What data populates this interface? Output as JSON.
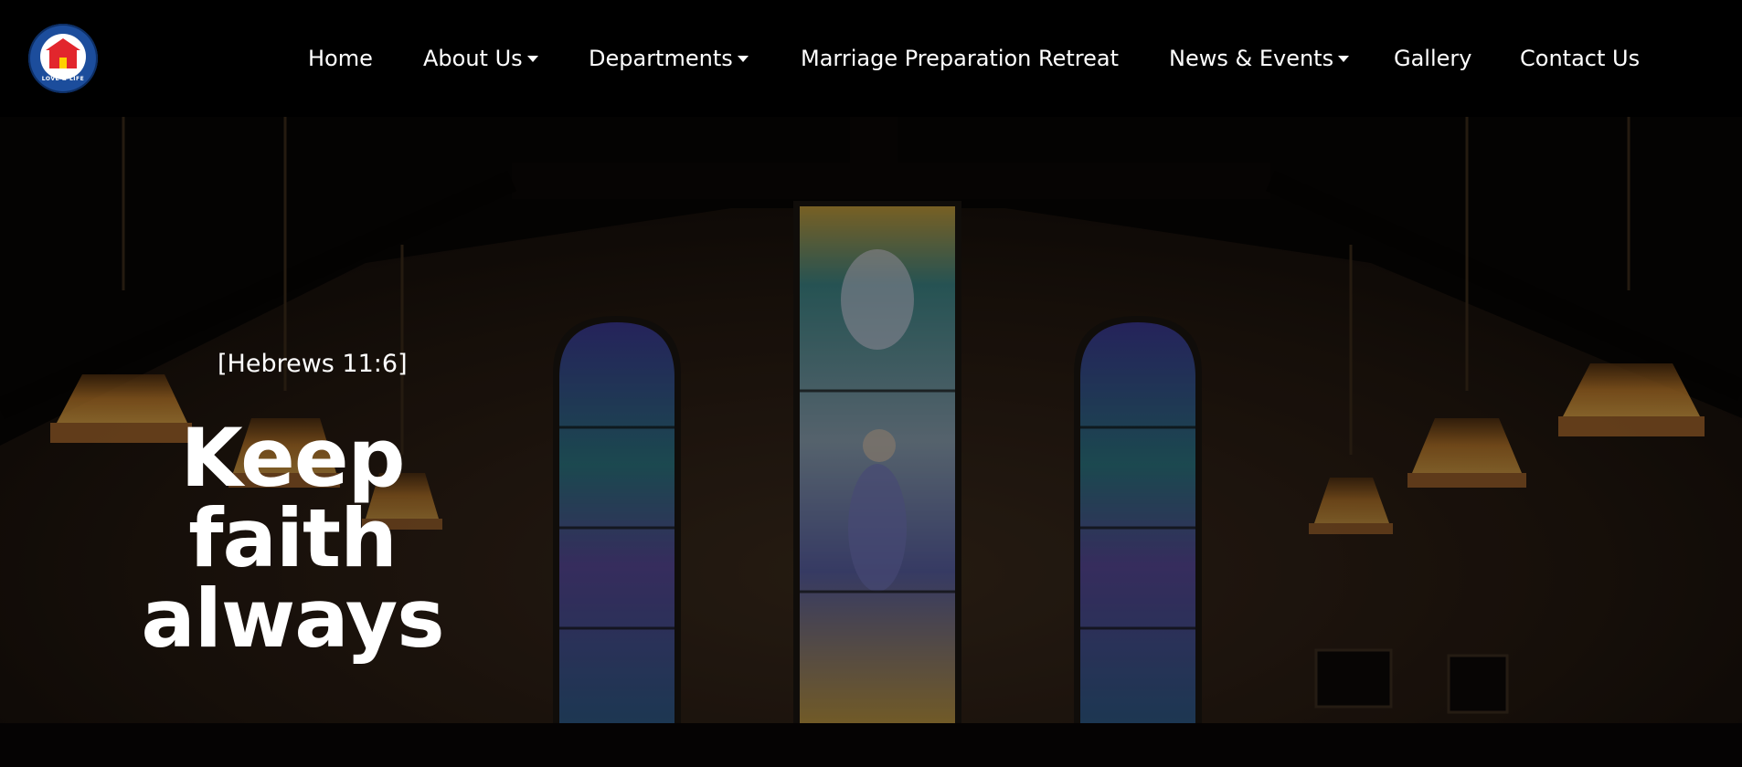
{
  "header": {
    "logo": {
      "ring_text": "LOVE & LIFE",
      "colors": {
        "ring": "#1c4d9c",
        "house": "#e2262d",
        "door": "#ffd200"
      }
    },
    "nav": [
      {
        "label": "Home",
        "has_dropdown": false
      },
      {
        "label": "About Us",
        "has_dropdown": true
      },
      {
        "label": "Departments",
        "has_dropdown": true
      },
      {
        "label": "Marriage Preparation Retreat",
        "has_dropdown": false
      },
      {
        "label": "News & Events",
        "has_dropdown": true
      },
      {
        "label": "Gallery",
        "has_dropdown": false
      },
      {
        "label": "Contact Us",
        "has_dropdown": false
      }
    ]
  },
  "hero": {
    "verse": "[Hebrews 11:6]",
    "headline": [
      "Keep",
      "faith",
      "always"
    ],
    "background": "church interior with stained glass windows and hanging lanterns"
  },
  "colors": {
    "header_bg": "#000000",
    "text": "#ffffff",
    "lantern_glow": "#f0a640"
  }
}
